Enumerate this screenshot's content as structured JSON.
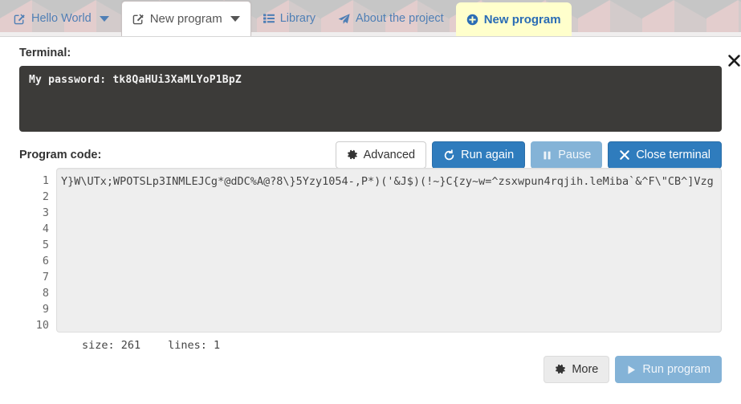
{
  "tabs": [
    {
      "label": "Hello World",
      "icon": "edit-square-icon",
      "caret": true,
      "state": "inactive"
    },
    {
      "label": "New program",
      "icon": "edit-square-icon",
      "caret": true,
      "state": "active"
    },
    {
      "label": "Library",
      "icon": "list-icon",
      "caret": false,
      "state": "inactive"
    },
    {
      "label": "About the project",
      "icon": "paper-plane-icon",
      "caret": false,
      "state": "inactive"
    },
    {
      "label": "New program",
      "icon": "plus-circle-icon",
      "caret": false,
      "state": "new"
    }
  ],
  "terminal": {
    "label": "Terminal:",
    "close_icon": "close-icon",
    "output": "My password: tk8QaHUi3XaMLYoP1BpZ",
    "background": "#3c3b39"
  },
  "terminal_buttons": [
    {
      "label": "Advanced",
      "icon": "gear-icon",
      "style": "default"
    },
    {
      "label": "Run again",
      "icon": "refresh-icon",
      "style": "primary"
    },
    {
      "label": "Pause",
      "icon": "pause-icon",
      "style": "muted"
    },
    {
      "label": "Close terminal",
      "icon": "close-icon",
      "style": "primary"
    }
  ],
  "code_panel": {
    "label": "Program code:",
    "line_numbers": [
      "1",
      "2",
      "3",
      "4",
      "5",
      "6",
      "7",
      "8",
      "9",
      "10"
    ],
    "code_line": "Y}W\\UTx;WPOTSLp3INMLEJCg*@dDC%A@?8\\}5Yzy1054-,P*)('&J$)(!~}C{zy~w=^zsxwpun4rqjih.leMiba`&^F\\\"CB^]Vzg",
    "status_size": "size:  261",
    "status_lines": "lines: 1"
  },
  "bottom_buttons": [
    {
      "label": "More",
      "icon": "gear-icon",
      "style": "light"
    },
    {
      "label": "Run program",
      "icon": "play-icon",
      "style": "muted"
    }
  ],
  "colors": {
    "accent_blue": "#2f7cbd",
    "link_blue": "#4f7fb5",
    "new_tab_yellow": "#ffffcc",
    "terminal_bg": "#3c3b39",
    "code_bg": "#eeeeee"
  }
}
